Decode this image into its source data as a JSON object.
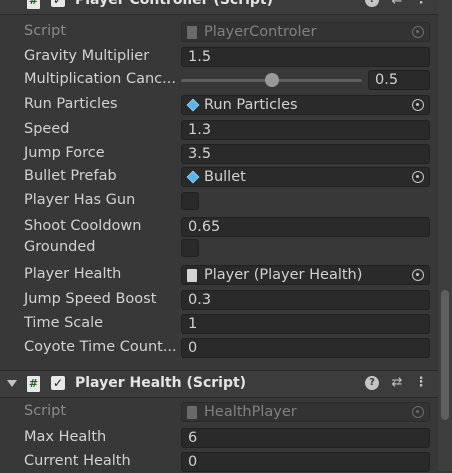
{
  "components": [
    {
      "title": "Player Controller (Script)",
      "script_label": "Script",
      "script_value": "PlayerControler",
      "properties": [
        {
          "label": "Gravity Multiplier",
          "value": "1.5"
        },
        {
          "label": "Multiplication Canc...",
          "value": "0.5",
          "slider": 0.5
        },
        {
          "label": "Run Particles",
          "value": "Run Particles",
          "icon": "prefab-cube-icon"
        },
        {
          "label": "Speed",
          "value": "1.3"
        },
        {
          "label": "Jump Force",
          "value": "3.5"
        },
        {
          "label": "Bullet Prefab",
          "value": "Bullet",
          "icon": "prefab-cube-icon"
        },
        {
          "label": "Player Has Gun",
          "checked": false
        },
        {
          "label": "Shoot Cooldown",
          "value": "0.65"
        },
        {
          "label": "Grounded",
          "checked": false
        },
        {
          "label": "Player Health",
          "value": "Player (Player Health)",
          "icon": "script-icon"
        },
        {
          "label": "Jump Speed Boost",
          "value": "0.3"
        },
        {
          "label": "Time Scale",
          "value": "1"
        },
        {
          "label": "Coyote Time Count...",
          "value": "0"
        }
      ]
    },
    {
      "title": "Player Health (Script)",
      "script_label": "Script",
      "script_value": "HealthPlayer",
      "properties": [
        {
          "label": "Max Health",
          "value": "6"
        },
        {
          "label": "Current Health",
          "value": "0"
        }
      ]
    }
  ],
  "header_icons": {
    "help": "?",
    "preset": "⇄",
    "menu": "⋮",
    "script_glyph": "#",
    "check": "✓"
  }
}
